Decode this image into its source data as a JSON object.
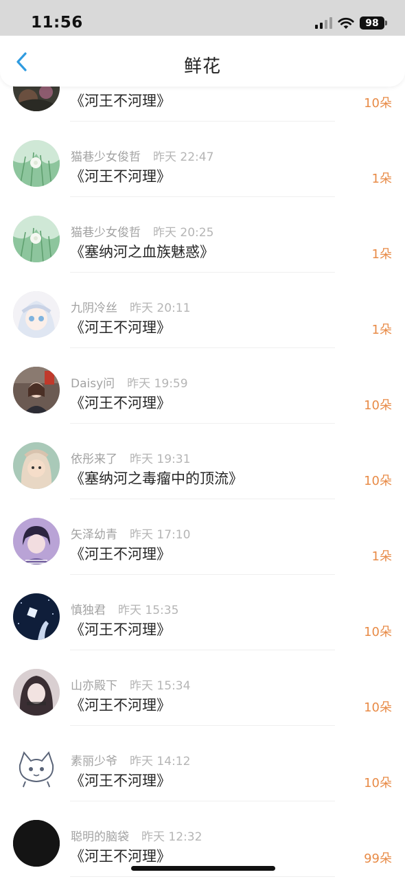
{
  "status_bar": {
    "time": "11:56",
    "battery": "98",
    "icons": [
      "signal-icon",
      "wifi-icon",
      "battery-icon"
    ]
  },
  "header": {
    "title": "鲜花",
    "back_icon": "chevron-left-icon"
  },
  "colors": {
    "accent": "#2f9be0",
    "count": "#e88b47",
    "name": "#a2a2a2",
    "text": "#262626"
  },
  "rows": [
    {
      "name": "",
      "time": "",
      "book": "《河王不河理》",
      "count": "10朵"
    },
    {
      "name": "猫巷少女俊哲",
      "time": "昨天 22:47",
      "book": "《河王不河理》",
      "count": "1朵"
    },
    {
      "name": "猫巷少女俊哲",
      "time": "昨天 20:25",
      "book": "《塞纳河之血族魅惑》",
      "count": "1朵"
    },
    {
      "name": "九阴冷丝",
      "time": "昨天 20:11",
      "book": "《河王不河理》",
      "count": "1朵"
    },
    {
      "name": "Daisy问",
      "time": "昨天 19:59",
      "book": "《河王不河理》",
      "count": "10朵"
    },
    {
      "name": "依彤来了",
      "time": "昨天 19:31",
      "book": "《塞纳河之毒瘤中的顶流》",
      "count": "10朵"
    },
    {
      "name": "矢泽幼青",
      "time": "昨天 17:10",
      "book": "《河王不河理》",
      "count": "1朵"
    },
    {
      "name": "慎独君",
      "time": "昨天 15:35",
      "book": "《河王不河理》",
      "count": "10朵"
    },
    {
      "name": "山亦殿下",
      "time": "昨天 15:34",
      "book": "《河王不河理》",
      "count": "10朵"
    },
    {
      "name": "素丽少爷",
      "time": "昨天 14:12",
      "book": "《河王不河理》",
      "count": "10朵"
    },
    {
      "name": "聪明的脑袋",
      "time": "昨天 12:32",
      "book": "《河王不河理》",
      "count": "99朵"
    }
  ]
}
